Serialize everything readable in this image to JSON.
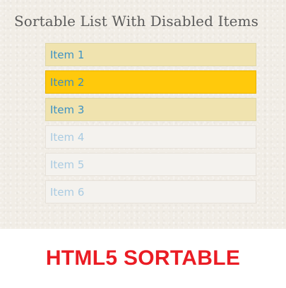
{
  "demo": {
    "title": "Sortable List With Disabled Items",
    "items": [
      {
        "label": "Item 1",
        "state": "enabled"
      },
      {
        "label": "Item 2",
        "state": "highlighted"
      },
      {
        "label": "Item 3",
        "state": "enabled"
      },
      {
        "label": "Item 4",
        "state": "disabled"
      },
      {
        "label": "Item 5",
        "state": "disabled"
      },
      {
        "label": "Item 6",
        "state": "disabled"
      }
    ]
  },
  "banner": {
    "text": "HTML5 SORTABLE"
  },
  "colors": {
    "panel_background": "#f1ede6",
    "item_enabled": "#f0e3af",
    "item_highlighted": "#ffc90c",
    "item_disabled": "#f4f2ee",
    "item_text": "#3d92c4",
    "item_text_disabled": "#a9cbe2",
    "banner_text": "#ea1c24"
  }
}
